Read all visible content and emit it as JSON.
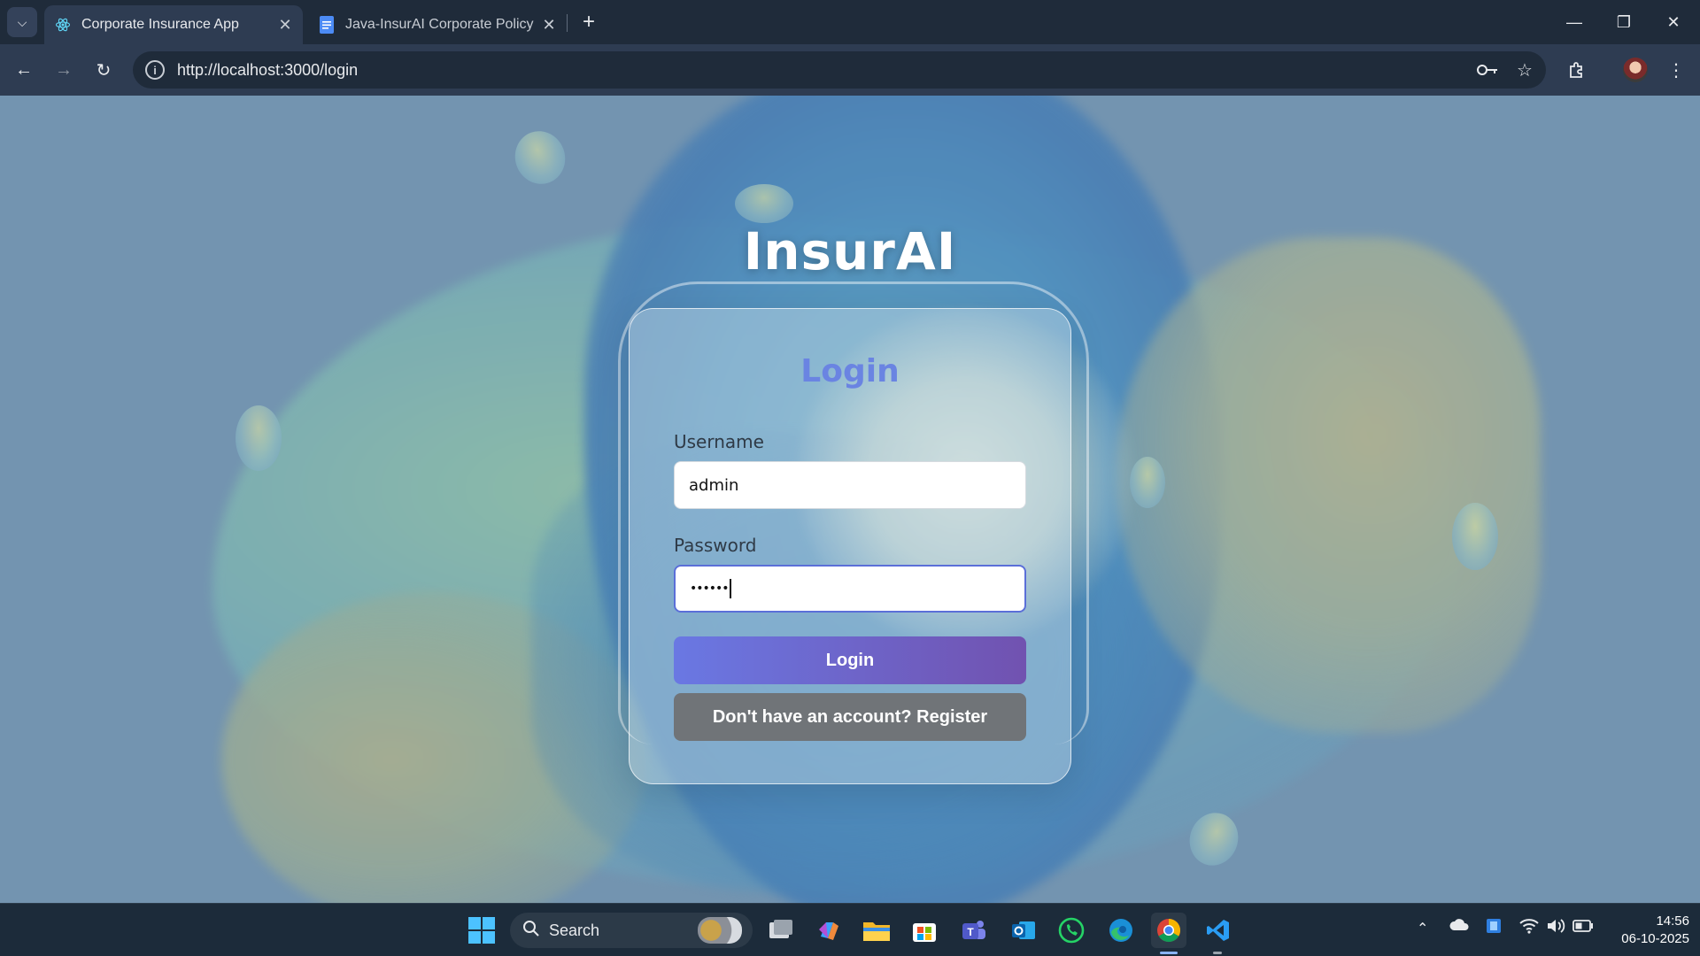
{
  "browser": {
    "tabs": [
      {
        "title": "Corporate Insurance App",
        "active": true,
        "icon": "react-icon"
      },
      {
        "title": "Java-InsurAI Corporate Policy A",
        "active": false,
        "icon": "docs-icon"
      }
    ],
    "url": "http://localhost:3000/login"
  },
  "page": {
    "app_title": "InsurAI",
    "form_title": "Login",
    "username_label": "Username",
    "username_value": "admin",
    "password_label": "Password",
    "password_value": "••••••",
    "login_button": "Login",
    "register_button": "Don't have an account? Register"
  },
  "taskbar": {
    "search_placeholder": "Search",
    "time": "14:56",
    "date": "06-10-2025"
  },
  "colors": {
    "title_accent": "#6a84e2",
    "login_gradient_start": "#6a78e3",
    "login_gradient_end": "#7152b0",
    "register_button": "#707478",
    "background": "#7394b0"
  }
}
